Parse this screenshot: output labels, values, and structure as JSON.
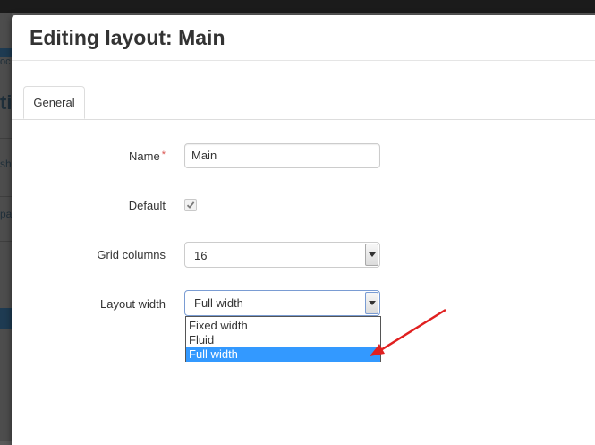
{
  "background": {
    "fragments": [
      "oc",
      "ti",
      "sh",
      "pa"
    ]
  },
  "modal": {
    "title": "Editing layout: Main",
    "tabs": [
      {
        "label": "General",
        "active": true
      }
    ]
  },
  "form": {
    "name": {
      "label": "Name",
      "required_marker": "*",
      "value": "Main"
    },
    "default": {
      "label": "Default",
      "checked": true
    },
    "grid_columns": {
      "label": "Grid columns",
      "value": "16"
    },
    "layout_width": {
      "label": "Layout width",
      "value": "Full width",
      "options": [
        "Fixed width",
        "Fluid",
        "Full width"
      ],
      "highlighted": "Full width"
    }
  },
  "colors": {
    "highlight": "#3399ff",
    "required": "#d9534f",
    "annotation_arrow": "#e02020"
  }
}
